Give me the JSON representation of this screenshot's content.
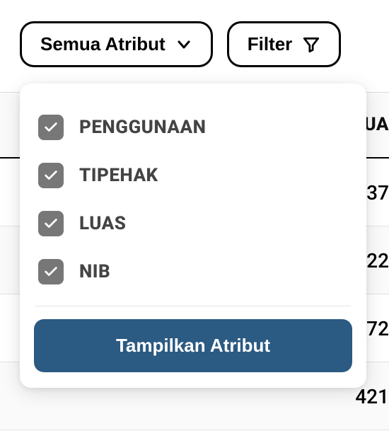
{
  "toolbar": {
    "attributes_button_label": "Semua Atribut",
    "filter_button_label": "Filter"
  },
  "dropdown": {
    "options": [
      {
        "label": "PENGGUNAAN",
        "checked": true
      },
      {
        "label": "TIPEHAK",
        "checked": true
      },
      {
        "label": "LUAS",
        "checked": true
      },
      {
        "label": "NIB",
        "checked": true
      }
    ],
    "apply_label": "Tampilkan Atribut"
  },
  "table": {
    "column_header_fragment": "UA",
    "rows": [
      {
        "value_fragment": "37"
      },
      {
        "value_fragment": "22"
      },
      {
        "value_fragment": "72"
      },
      {
        "value_fragment": "421"
      }
    ]
  },
  "icons": {
    "chevron_down": "chevron-down-icon",
    "funnel": "funnel-icon",
    "check": "check-icon"
  },
  "colors": {
    "primary": "#2b5a82",
    "checkbox_bg": "#777777"
  }
}
